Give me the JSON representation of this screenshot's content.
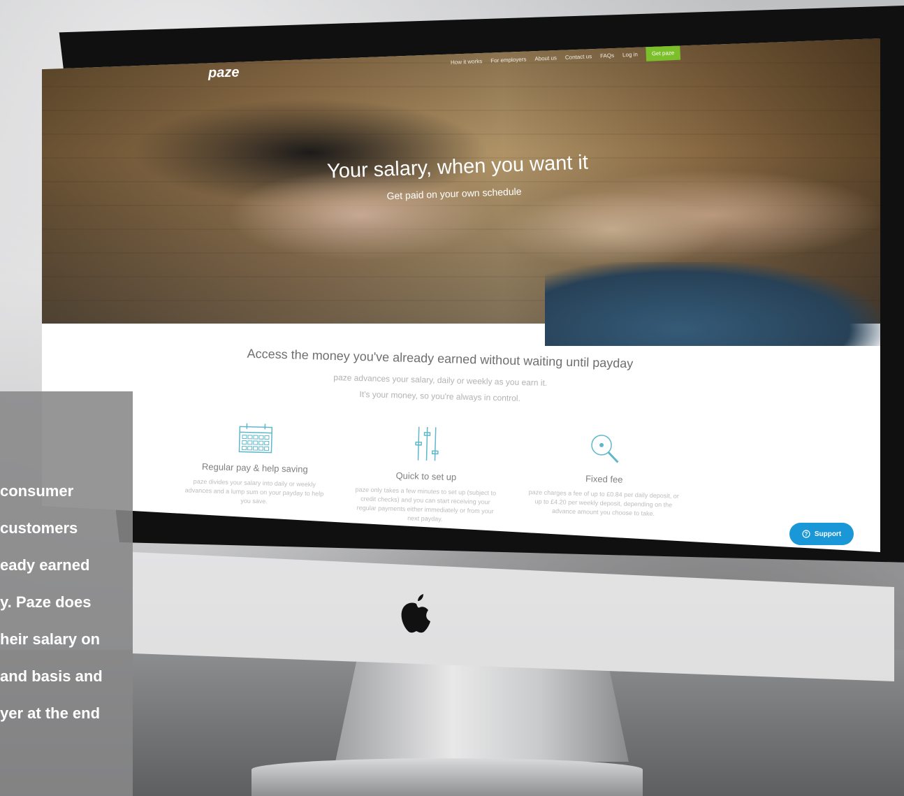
{
  "site": {
    "logo": "paze",
    "nav": [
      "How it works",
      "For employers",
      "About us",
      "Contact us",
      "FAQs",
      "Log in"
    ],
    "cta": "Get paze"
  },
  "hero": {
    "title": "Your salary, when you want it",
    "subtitle": "Get paid on your own schedule"
  },
  "intro": {
    "heading": "Access the money you've already earned without waiting until payday",
    "line1": "paze advances your salary, daily or weekly as you earn it.",
    "line2": "It's your money, so you're always in control."
  },
  "features": [
    {
      "icon": "calendar-icon",
      "title": "Regular pay & help saving",
      "text": "paze divides your salary into daily or weekly advances and a lump sum on your payday to help you save."
    },
    {
      "icon": "sliders-icon",
      "title": "Quick to set up",
      "text": "paze only takes a few minutes to set up (subject to credit checks) and you can start receiving your regular payments either immediately or from your next payday."
    },
    {
      "icon": "magnifier-icon",
      "title": "Fixed fee",
      "text": "paze charges a fee of up to £0.84 per daily deposit, or up to £4.20 per weekly deposit, depending on the advance amount you choose to take."
    }
  ],
  "support": {
    "label": "Support"
  },
  "caption": {
    "lines": [
      "consumer",
      "customers",
      "eady earned",
      "y. Paze does",
      "heir salary on",
      "and basis and",
      "yer at the end"
    ]
  },
  "colors": {
    "cta_green": "#7bbf2a",
    "support_blue": "#1a97d6",
    "feature_icon": "#5fb8c9"
  }
}
